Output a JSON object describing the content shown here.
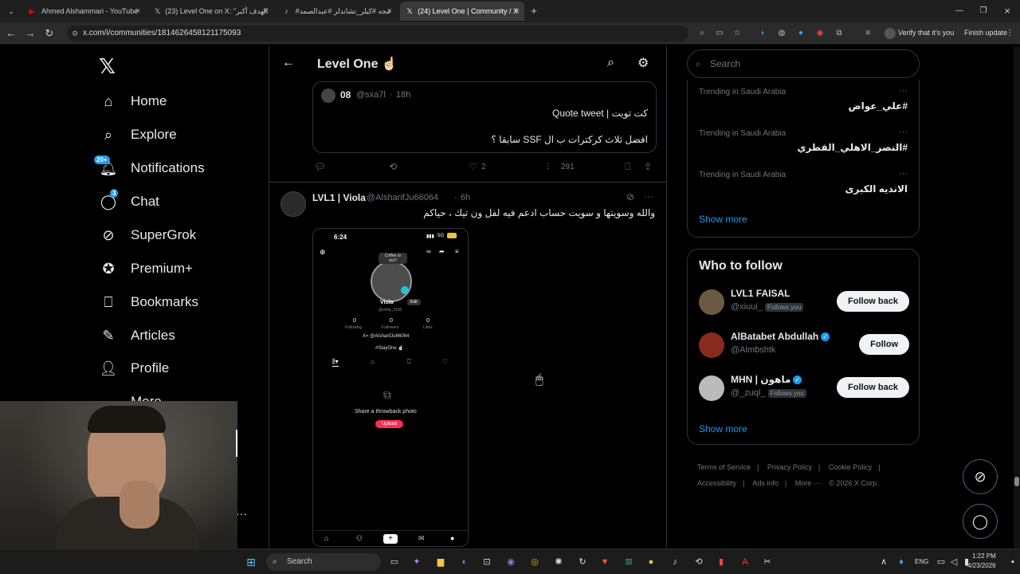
{
  "browser": {
    "tabs": [
      {
        "title": "Ahmed Alshammari - YouTube",
        "icon": "youtube-icon"
      },
      {
        "title": "(23) Level One on X: \"الهدف أكبر",
        "icon": "x-icon"
      },
      {
        "title": "#مجه #كيلر_تشاندلر #عبدالصمد",
        "icon": "tiktok-icon"
      },
      {
        "title": "(24) Level One | Community / X",
        "icon": "x-icon"
      }
    ],
    "url": "x.com/i/communities/1814626458121175093",
    "verify_label": "Verify that it's you",
    "finish_update_label": "Finish update"
  },
  "nav": {
    "items": [
      {
        "label": "Home",
        "icon": "home-icon"
      },
      {
        "label": "Explore",
        "icon": "search-icon"
      },
      {
        "label": "Notifications",
        "icon": "bell-icon",
        "badge": "20+"
      },
      {
        "label": "Chat",
        "icon": "chat-icon",
        "badge": "3"
      },
      {
        "label": "SuperGrok",
        "icon": "grok-icon"
      },
      {
        "label": "Premium+",
        "icon": "verified-icon"
      },
      {
        "label": "Bookmarks",
        "icon": "bookmark-icon"
      },
      {
        "label": "Articles",
        "icon": "articles-icon"
      },
      {
        "label": "Profile",
        "icon": "person-icon"
      },
      {
        "label": "More",
        "icon": "more-icon"
      }
    ]
  },
  "header": {
    "title": "Level One ☝🏻"
  },
  "quote": {
    "author_name": "08",
    "author_handle": "@sxa7l",
    "time": "18h",
    "line1": "كت تويت | Quote tweet",
    "line2": "افضل ثلاث كركترات ب ال SSF سابقا ؟"
  },
  "actions1": {
    "likes": "2",
    "views": "291"
  },
  "tweet": {
    "author_name": "LVL1 | Viola",
    "author_handle": "@AlsharifJu66064",
    "time": "6h",
    "text": "والله وسويتها و سويت حساب ادعم فيه لفل ون تيك ، حياكم"
  },
  "phone": {
    "time": "6:24",
    "signal": "5G",
    "bubble": "Coffee or tea?",
    "name": "Viola",
    "edit_label": "Edit",
    "handle": "@viola_3150",
    "stats": [
      {
        "value": "0",
        "label": "Following"
      },
      {
        "value": "0",
        "label": "Followers"
      },
      {
        "value": "0",
        "label": "Likes"
      }
    ],
    "bio1": "X= @AlsharifJu66064",
    "bio2": "#StayOne ☝🏻",
    "empty_text": "Share a throwback photo",
    "upload_label": "Upload"
  },
  "right": {
    "search_placeholder": "Search",
    "trends": [
      {
        "meta": "Trending in Saudi Arabia",
        "name": "#علي_عواض"
      },
      {
        "meta": "Trending in Saudi Arabia",
        "name": "#النصر_الاهلي_القطري"
      },
      {
        "meta": "Trending in Saudi Arabia",
        "name": "الانديه الكبرى"
      }
    ],
    "show_more": "Show more",
    "who_to_follow_title": "Who to follow",
    "follows": [
      {
        "name": "LVL1 FAISAL",
        "handle": "@xiuui_",
        "follows_you": "Follows you",
        "button": "Follow back",
        "verified": false
      },
      {
        "name": "AlBatabet Abdullah",
        "handle": "@Almbshtk",
        "follows_you": "",
        "button": "Follow",
        "verified": true
      },
      {
        "name": "MHN | ماهون",
        "handle": "@_zuql_",
        "follows_you": "Follows you",
        "button": "Follow back",
        "verified": true
      }
    ],
    "show_more2": "Show more"
  },
  "footer": {
    "links": [
      "Terms of Service",
      "Privacy Policy",
      "Cookie Policy",
      "Accessibility",
      "Ads info",
      "More ···"
    ],
    "copyright": "© 2026 X Corp."
  },
  "taskbar": {
    "search_label": "Search",
    "lang": "ENG",
    "time": "1:22 PM",
    "date": "4/23/2026"
  }
}
